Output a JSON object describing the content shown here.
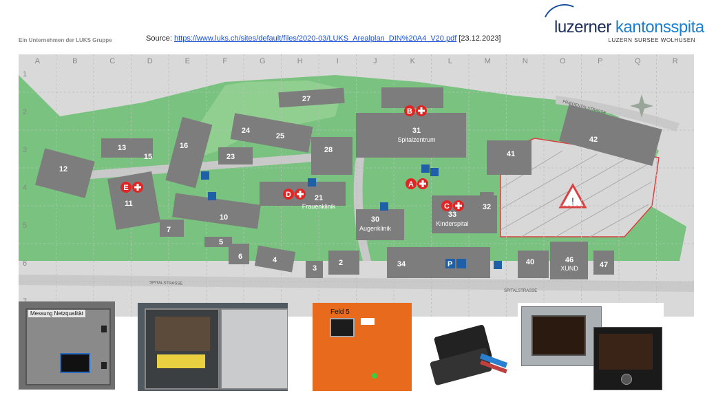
{
  "header": {
    "company_line": "Ein Unternehmen der LUKS Gruppe",
    "source_prefix": "Source: ",
    "source_url": "https://www.luks.ch/sites/default/files/2020-03/LUKS_Arealplan_DIN%20A4_V20.pdf",
    "source_date": " [23.12.2023]"
  },
  "logo": {
    "word1": "luzerner ",
    "word2": "kantonsspital",
    "subtitle": "LUZERN SURSEE WOLHUSEN"
  },
  "map": {
    "grid_columns": [
      "A",
      "B",
      "C",
      "D",
      "E",
      "F",
      "G",
      "H",
      "I",
      "J",
      "K",
      "L",
      "M",
      "N",
      "O",
      "P",
      "Q",
      "R"
    ],
    "grid_rows": [
      "1",
      "2",
      "3",
      "4",
      "5",
      "6",
      "7"
    ],
    "colors": {
      "grass": "#7ac27f",
      "road": "#d6d6d6",
      "building": "#7d7d7d",
      "emergency": "#e02525",
      "blue": "#1f5fa8",
      "construction": "#d94040"
    },
    "buildings": [
      {
        "label": "27"
      },
      {
        "label": "31",
        "name": "Spitalzentrum"
      },
      {
        "label": "24"
      },
      {
        "label": "25"
      },
      {
        "label": "16"
      },
      {
        "label": "13"
      },
      {
        "label": "15"
      },
      {
        "label": "23"
      },
      {
        "label": "28"
      },
      {
        "label": "12"
      },
      {
        "label": "11"
      },
      {
        "label": "21",
        "name": "Frauenklinik"
      },
      {
        "label": "10"
      },
      {
        "label": "7"
      },
      {
        "label": "30",
        "name": "Augenklinik"
      },
      {
        "label": "33",
        "name": "Kinderspital"
      },
      {
        "label": "32"
      },
      {
        "label": "41"
      },
      {
        "label": "42"
      },
      {
        "label": "5"
      },
      {
        "label": "6"
      },
      {
        "label": "4"
      },
      {
        "label": "3"
      },
      {
        "label": "2"
      },
      {
        "label": "34"
      },
      {
        "label": "40"
      },
      {
        "label": "46",
        "name": "XUND"
      },
      {
        "label": "47"
      }
    ],
    "emergency_markers": [
      "A",
      "B",
      "C",
      "D",
      "E"
    ],
    "street_labels": [
      "FRIEDENTALSTRASSE",
      "SPITALSTRASSE",
      "SPITALSTRASSE"
    ]
  },
  "photos": [
    {
      "caption": "Messung Netzqualität"
    },
    {
      "caption": ""
    },
    {
      "caption": "Feld 5"
    },
    {
      "caption": ""
    },
    {
      "caption": ""
    }
  ]
}
